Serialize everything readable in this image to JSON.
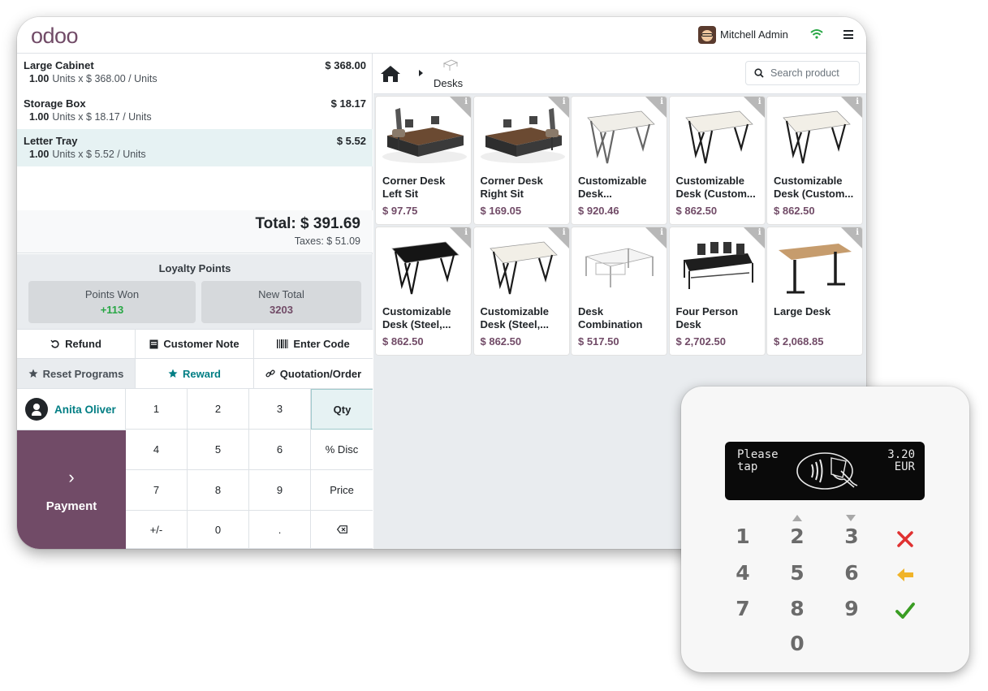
{
  "topbar": {
    "logo": "odoo",
    "user_name": "Mitchell Admin"
  },
  "order": {
    "lines": [
      {
        "name": "Large Cabinet",
        "price": "$ 368.00",
        "qty": "1.00",
        "detail": "Units x $ 368.00 / Units",
        "selected": false
      },
      {
        "name": "Storage Box",
        "price": "$ 18.17",
        "qty": "1.00",
        "detail": "Units x $ 18.17 / Units",
        "selected": false
      },
      {
        "name": "Letter Tray",
        "price": "$ 5.52",
        "qty": "1.00",
        "detail": "Units x $ 5.52 / Units",
        "selected": true
      }
    ],
    "total": "Total: $ 391.69",
    "taxes": "Taxes: $ 51.09"
  },
  "loyalty": {
    "title": "Loyalty Points",
    "points_won_label": "Points Won",
    "points_won_value": "+113",
    "new_total_label": "New Total",
    "new_total_value": "3203"
  },
  "actions": {
    "refund": "Refund",
    "customer_note": "Customer Note",
    "enter_code": "Enter Code",
    "reset_programs": "Reset Programs",
    "reward": "Reward",
    "quotation": "Quotation/Order"
  },
  "customer": {
    "name": "Anita Oliver"
  },
  "payment": {
    "label": "Payment"
  },
  "numpad": {
    "keys": [
      "1",
      "2",
      "3",
      "Qty",
      "4",
      "5",
      "6",
      "% Disc",
      "7",
      "8",
      "9",
      "Price",
      "+/-",
      "0",
      "."
    ]
  },
  "catalog": {
    "breadcrumb": "Desks",
    "search_placeholder": "Search product",
    "products": [
      {
        "name": "Corner Desk Left Sit",
        "price": "$ 97.75",
        "img": "corner-left"
      },
      {
        "name": "Corner Desk Right Sit",
        "price": "$ 169.05",
        "img": "corner-right"
      },
      {
        "name": "Customizable Desk...",
        "price": "$ 920.46",
        "img": "desk-white"
      },
      {
        "name": "Customizable Desk (Custom...",
        "price": "$ 862.50",
        "img": "desk-white-black"
      },
      {
        "name": "Customizable Desk (Custom...",
        "price": "$ 862.50",
        "img": "desk-white-black"
      },
      {
        "name": "Customizable Desk (Steel,...",
        "price": "$ 862.50",
        "img": "desk-black"
      },
      {
        "name": "Customizable Desk (Steel,...",
        "price": "$ 862.50",
        "img": "desk-white-black"
      },
      {
        "name": "Desk Combination",
        "price": "$ 517.50",
        "img": "desk-combo"
      },
      {
        "name": "Four Person Desk",
        "price": "$ 2,702.50",
        "img": "four-person"
      },
      {
        "name": "Large Desk",
        "price": "$ 2,068.85",
        "img": "large-desk"
      }
    ]
  },
  "terminal": {
    "screen_left": "Please\ntap",
    "screen_amount": "3.20",
    "screen_currency": "EUR",
    "keys": [
      "1",
      "2",
      "3",
      "4",
      "5",
      "6",
      "7",
      "8",
      "9",
      "0"
    ]
  },
  "colors": {
    "brand": "#714B67",
    "teal": "#017e84",
    "points_won": "#28a745",
    "cancel": "#e03131",
    "clear": "#f0b429",
    "confirm": "#3a9d23"
  }
}
